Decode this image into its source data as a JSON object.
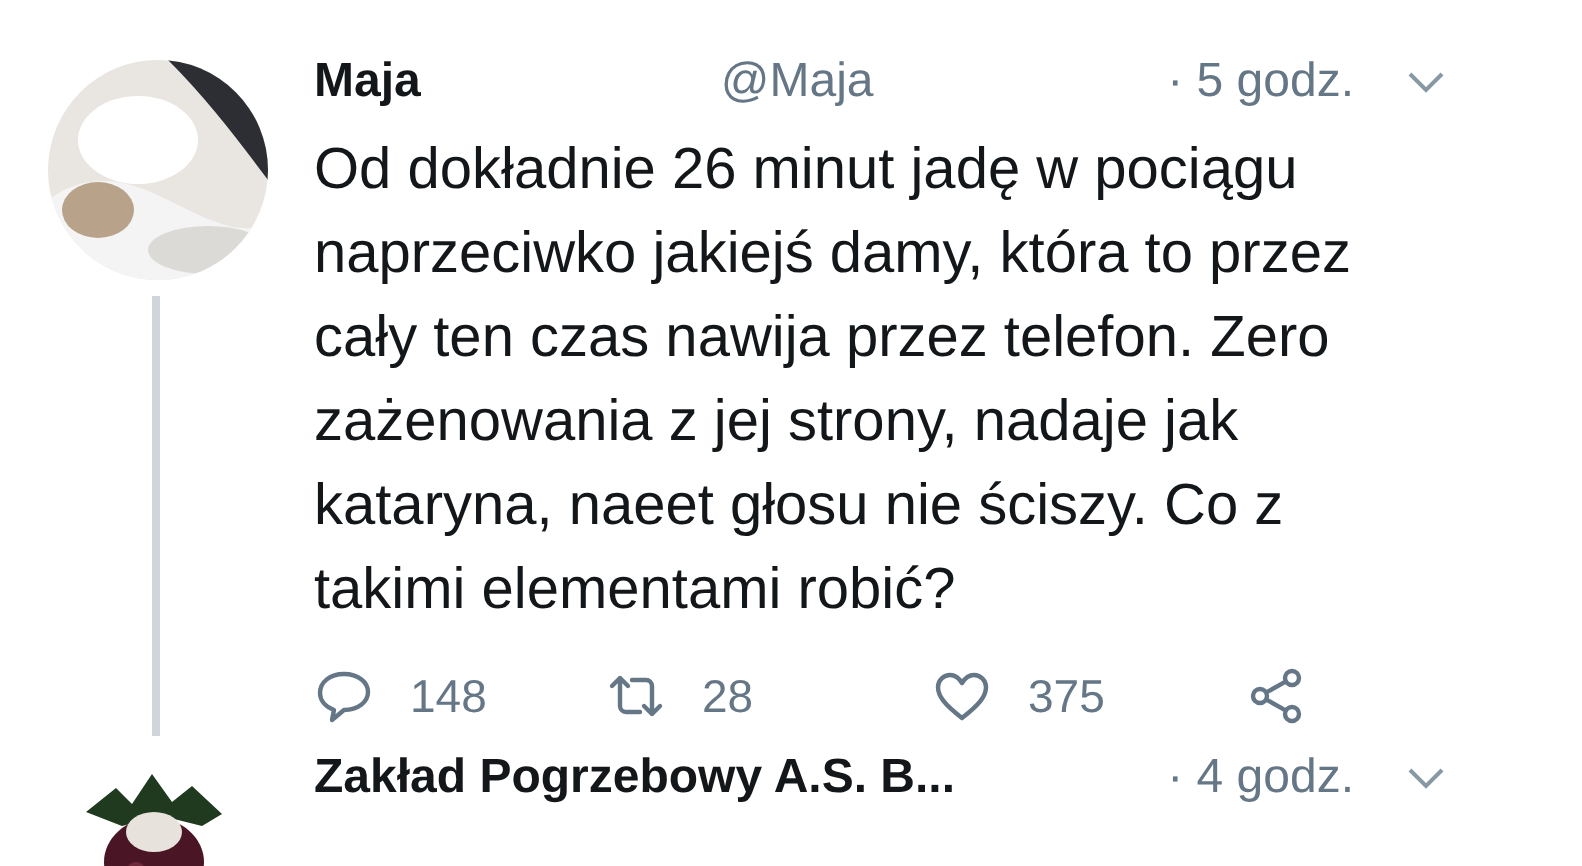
{
  "tweets": [
    {
      "name": "Maja",
      "handle": "@Maja",
      "time": "· 5 godz.",
      "text": "Od dokładnie 26 minut jadę w pociągu naprzeciwko jakiejś damy, która to przez cały ten czas nawija przez telefon. Zero zażenowania z jej strony, nadaje jak kataryna, naeet głosu nie ściszy. Co z takimi elementami robić?",
      "thread": true,
      "actions": [
        {
          "kind": "reply",
          "count": "148"
        },
        {
          "kind": "retweet",
          "count": "28"
        },
        {
          "kind": "like",
          "count": "375"
        },
        {
          "kind": "share"
        }
      ]
    },
    {
      "name": "Zakład Pogrzebowy A.S. B...",
      "time": "· 4 godz.",
      "thread": false
    }
  ]
}
